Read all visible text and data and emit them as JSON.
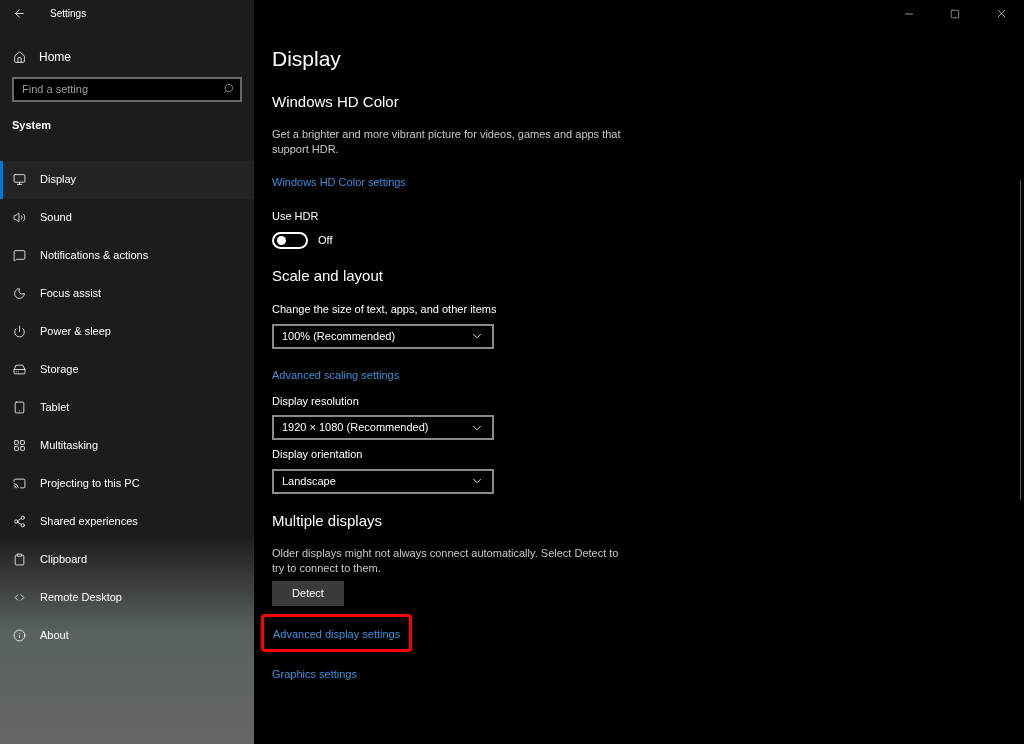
{
  "window": {
    "title": "Settings"
  },
  "sidebar": {
    "home": "Home",
    "search": {
      "placeholder": "Find a setting"
    },
    "group": "System",
    "items": [
      {
        "label": "Display",
        "selected": true
      },
      {
        "label": "Sound",
        "selected": false
      },
      {
        "label": "Notifications & actions",
        "selected": false
      },
      {
        "label": "Focus assist",
        "selected": false
      },
      {
        "label": "Power & sleep",
        "selected": false
      },
      {
        "label": "Storage",
        "selected": false
      },
      {
        "label": "Tablet",
        "selected": false
      },
      {
        "label": "Multitasking",
        "selected": false
      },
      {
        "label": "Projecting to this PC",
        "selected": false
      },
      {
        "label": "Shared experiences",
        "selected": false
      },
      {
        "label": "Clipboard",
        "selected": false
      },
      {
        "label": "Remote Desktop",
        "selected": false
      },
      {
        "label": "About",
        "selected": false
      }
    ]
  },
  "page": {
    "title": "Display",
    "sections": [
      {
        "heading": "Windows HD Color",
        "blocks": [
          {
            "kind": "text",
            "text": "Get a brighter and more vibrant picture for videos, games and apps that support HDR."
          },
          {
            "kind": "link",
            "text": "Windows HD Color settings",
            "highlighted": false
          },
          {
            "kind": "toggle",
            "label": "Use HDR",
            "on": false,
            "state_text": "Off"
          }
        ]
      },
      {
        "heading": "Scale and layout",
        "blocks": [
          {
            "kind": "dropdown",
            "label": "Change the size of text, apps, and other items",
            "value": "100% (Recommended)"
          },
          {
            "kind": "link",
            "text": "Advanced scaling settings",
            "highlighted": false
          },
          {
            "kind": "dropdown",
            "label": "Display resolution",
            "value": "1920 × 1080 (Recommended)"
          },
          {
            "kind": "dropdown",
            "label": "Display orientation",
            "value": "Landscape"
          }
        ]
      },
      {
        "heading": "Multiple displays",
        "blocks": [
          {
            "kind": "text",
            "text": "Older displays might not always connect automatically. Select Detect to try to connect to them."
          },
          {
            "kind": "button",
            "text": "Detect"
          },
          {
            "kind": "link",
            "text": "Advanced display settings",
            "highlighted": true
          },
          {
            "kind": "link",
            "text": "Graphics settings",
            "highlighted": false
          }
        ]
      }
    ]
  }
}
